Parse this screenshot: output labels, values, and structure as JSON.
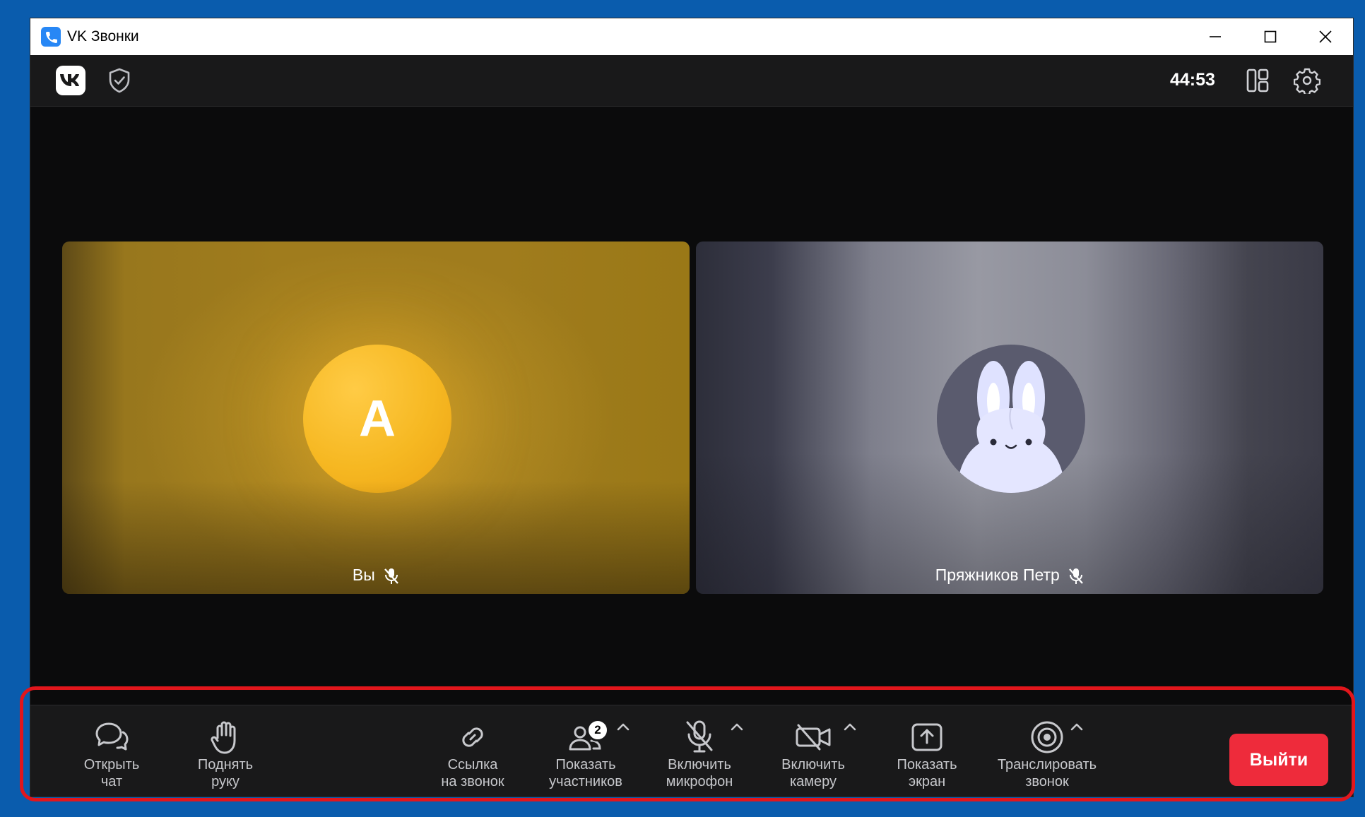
{
  "window": {
    "title": "VK Звонки"
  },
  "header": {
    "timer": "44:53"
  },
  "tiles": [
    {
      "name": "Вы",
      "avatar_letter": "A"
    },
    {
      "name": "Пряжников Петр"
    }
  ],
  "toolbar": {
    "chat": "Открыть\nчат",
    "hand": "Поднять\nруку",
    "link": "Ссылка\nна звонок",
    "participants": "Показать\nучастников",
    "participants_count": "2",
    "mic": "Включить\nмикрофон",
    "camera": "Включить\nкамеру",
    "screen": "Показать\nэкран",
    "broadcast": "Транслировать\nзвонок",
    "leave": "Выйти"
  },
  "colors": {
    "leave_button": "#ee2b3b",
    "annotation": "#e2161c",
    "desktop": "#0a5cad"
  }
}
